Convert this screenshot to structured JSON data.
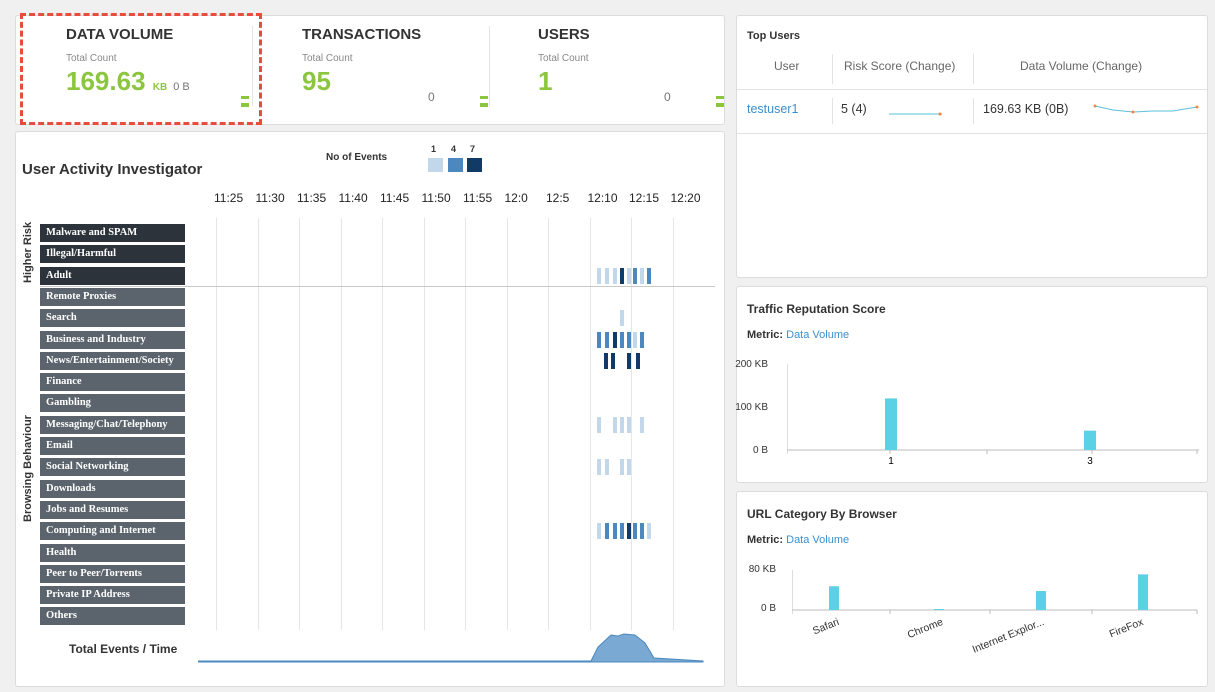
{
  "kpis": [
    {
      "title": "DATA VOLUME",
      "sub": "Total Count",
      "value": "169.63",
      "unit": "KB",
      "small": "0 B",
      "change": ""
    },
    {
      "title": "TRANSACTIONS",
      "sub": "Total Count",
      "value": "95",
      "unit": "",
      "small": "",
      "change": "0"
    },
    {
      "title": "USERS",
      "sub": "Total Count",
      "value": "1",
      "unit": "",
      "small": "",
      "change": "0"
    }
  ],
  "activity": {
    "title": "User Activity Investigator",
    "legend_title": "No of Events",
    "legend": [
      {
        "n": "1",
        "color": "#c2d7ea"
      },
      {
        "n": "4",
        "color": "#4a88bf"
      },
      {
        "n": "7",
        "color": "#123a66"
      }
    ],
    "times": [
      "11:25",
      "11:30",
      "11:35",
      "11:40",
      "11:45",
      "11:50",
      "11:55",
      "12:0",
      "12:5",
      "12:10",
      "12:15",
      "12:20"
    ],
    "group_higher": "Higher Risk",
    "group_browsing": "Browsing Behaviour",
    "higher_risk": [
      "Malware and SPAM",
      "Illegal/Harmful",
      "Adult"
    ],
    "browsing": [
      "Remote Proxies",
      "Search",
      "Business and Industry",
      "News/Entertainment/Society",
      "Finance",
      "Gambling",
      "Messaging/Chat/Telephony",
      "Email",
      "Social Networking",
      "Downloads",
      "Jobs and Resumes",
      "Computing and Internet",
      "Health",
      "Peer to Peer/Torrents",
      "Private IP Address",
      "Others"
    ],
    "total_label": "Total Events / Time"
  },
  "top_users": {
    "title": "Top Users",
    "headers": [
      "User",
      "Risk Score (Change)",
      "Data Volume (Change)"
    ],
    "rows": [
      {
        "user": "testuser1",
        "risk": "5 (4)",
        "volume": "169.63 KB (0B)"
      }
    ]
  },
  "traffic": {
    "title": "Traffic Reputation Score",
    "metric_label": "Metric:",
    "metric_value": "Data Volume",
    "yticks": [
      "200 KB",
      "100 KB",
      "0 B"
    ]
  },
  "url_browser": {
    "title": "URL Category By Browser",
    "metric_label": "Metric:",
    "metric_value": "Data Volume",
    "yticks": [
      "80 KB",
      "0 B"
    ]
  },
  "chart_data": [
    {
      "type": "bar",
      "title": "Traffic Reputation Score",
      "categories": [
        "1",
        "3"
      ],
      "values": [
        120,
        45
      ],
      "ylim": [
        0,
        200
      ],
      "ylabel": "",
      "xlabel": "",
      "color": "#5bd1e6"
    },
    {
      "type": "bar",
      "title": "URL Category By Browser",
      "categories": [
        "Safari",
        "Chrome",
        "Internet Explor...",
        "FireFox"
      ],
      "values": [
        50,
        2,
        40,
        75
      ],
      "ylim": [
        0,
        80
      ],
      "ylabel": "",
      "xlabel": "",
      "color": "#5bd1e6"
    }
  ],
  "colors": {
    "accent_green": "#8cc63f",
    "highlight_red": "#e74c3c",
    "link_blue": "#3a8fd0",
    "bar_cyan": "#5bd1e6"
  }
}
